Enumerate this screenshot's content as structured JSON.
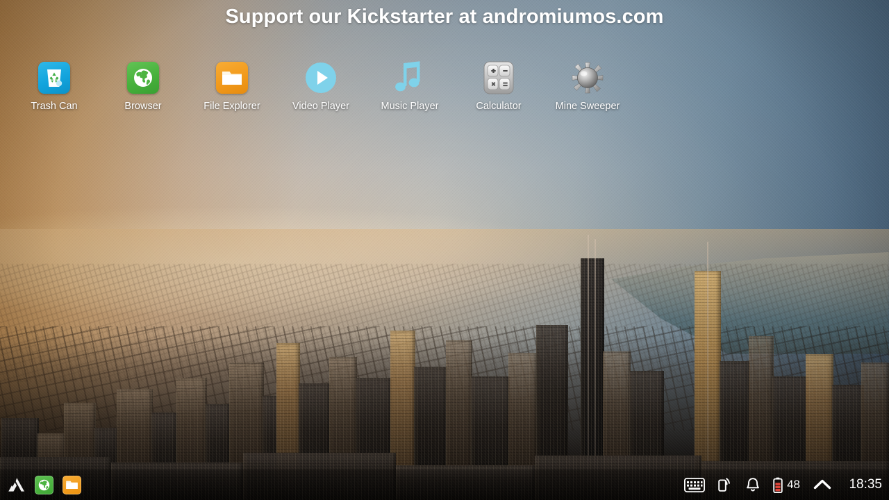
{
  "banner": {
    "text": "Support our Kickstarter at andromiumos.com"
  },
  "desktop": {
    "icons": [
      {
        "label": "Trash Can",
        "icon": "trash-can-icon",
        "color": "#12a4dd"
      },
      {
        "label": "Browser",
        "icon": "globe-browser-icon",
        "color": "#47b13c"
      },
      {
        "label": "File Explorer",
        "icon": "folder-icon",
        "color": "#f29a1c"
      },
      {
        "label": "Video Player",
        "icon": "play-circle-icon",
        "color": "#7fd2ea"
      },
      {
        "label": "Music Player",
        "icon": "music-note-icon",
        "color": "#7fd2ea"
      },
      {
        "label": "Calculator",
        "icon": "calculator-icon",
        "color": "#c9c9c9"
      },
      {
        "label": "Mine Sweeper",
        "icon": "mine-icon",
        "color": "#b8b8b8"
      }
    ]
  },
  "taskbar": {
    "launcher": {
      "label": "Andromium",
      "icon": "andromium-logo-icon"
    },
    "running": [
      {
        "label": "Browser",
        "icon": "globe-browser-icon",
        "color": "#3fa835"
      },
      {
        "label": "File Explorer",
        "icon": "folder-icon",
        "color": "#ed920f"
      }
    ],
    "tray": {
      "keyboard": {
        "label": "Keyboard",
        "icon": "keyboard-icon"
      },
      "cast": {
        "label": "Cast",
        "icon": "phone-signal-icon"
      },
      "notifications": {
        "label": "Notifications",
        "icon": "bell-icon"
      },
      "battery": {
        "label": "Battery",
        "icon": "battery-icon",
        "percent": "48",
        "level_color": "#e0453a"
      },
      "expand": {
        "label": "Show hidden icons",
        "icon": "chevron-up-icon"
      },
      "clock": {
        "time": "18:35"
      }
    }
  },
  "colors": {
    "text_on_wallpaper": "#ffffff",
    "accent_blue": "#7fd2ea",
    "battery_red": "#e0453a"
  }
}
